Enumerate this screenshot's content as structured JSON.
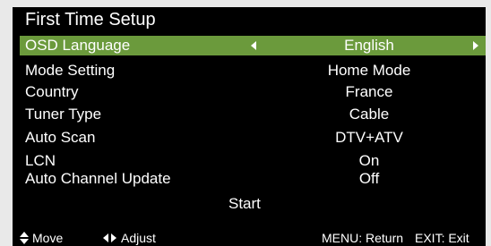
{
  "title": "First Time Setup",
  "colors": {
    "background": "#000000",
    "frame": "#e9e9e9",
    "highlight": "#6b9a3c",
    "text": "#ffffff"
  },
  "menu": [
    {
      "label": "OSD Language",
      "value": "English",
      "selected": true
    },
    {
      "label": "Mode Setting",
      "value": "Home Mode",
      "selected": false
    },
    {
      "label": "Country",
      "value": "France",
      "selected": false
    },
    {
      "label": "Tuner Type",
      "value": "Cable",
      "selected": false
    },
    {
      "label": "Auto Scan",
      "value": "DTV+ATV",
      "selected": false
    },
    {
      "label": "LCN",
      "value": "On",
      "selected": false
    },
    {
      "label": "Auto Channel Update",
      "value": "Off",
      "selected": false
    }
  ],
  "start_label": "Start",
  "footer": {
    "move_icon": "up-down-arrows-icon",
    "move_label": "Move",
    "adjust_icon": "left-right-arrows-icon",
    "adjust_label": "Adjust",
    "menu_hint": "MENU: Return",
    "exit_hint": "EXIT: Exit"
  }
}
